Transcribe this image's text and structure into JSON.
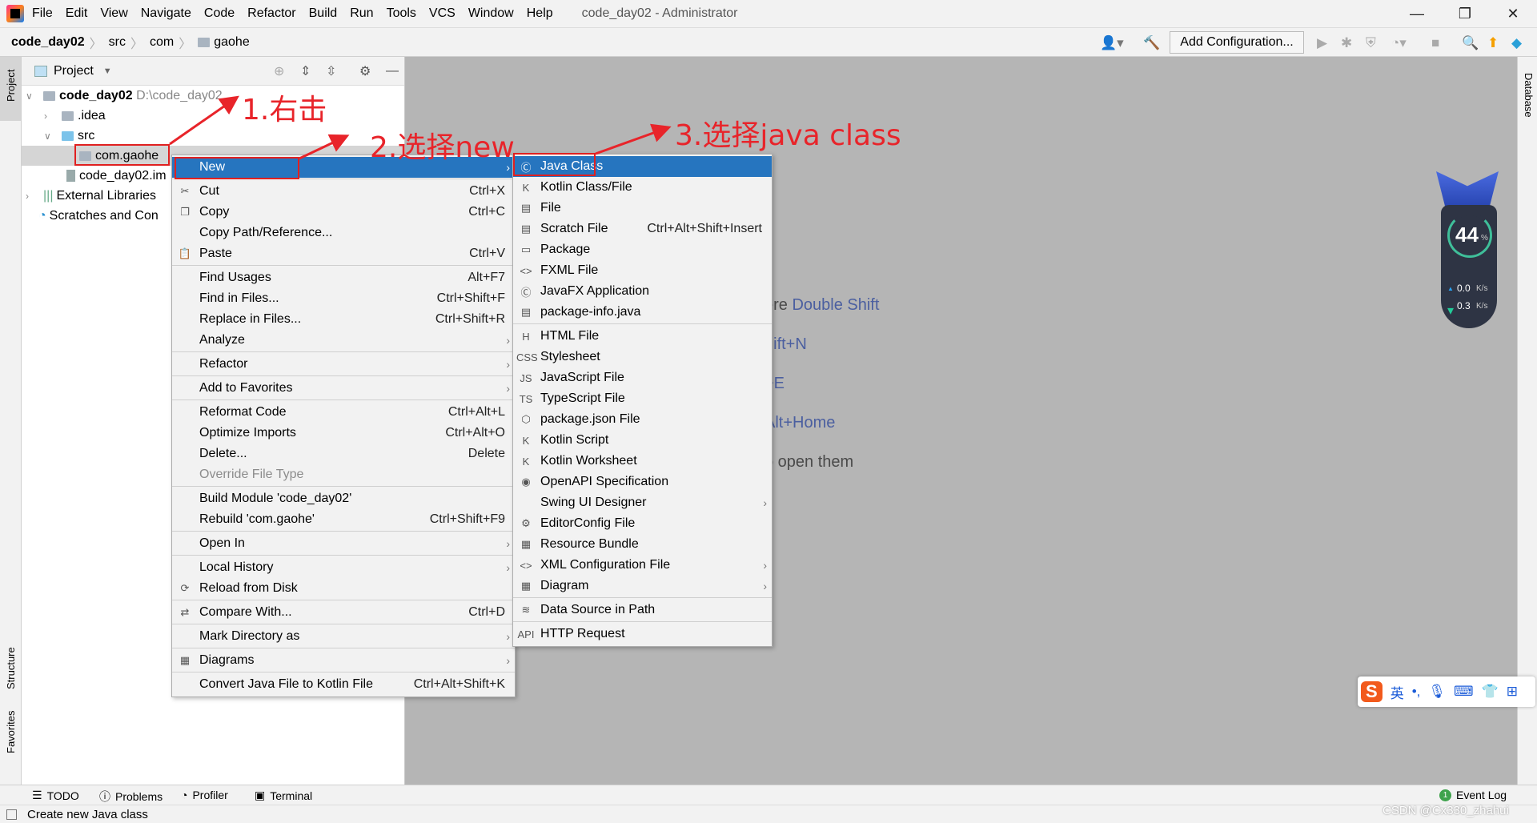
{
  "titlebar": {
    "menus": [
      "File",
      "Edit",
      "View",
      "Navigate",
      "Code",
      "Refactor",
      "Build",
      "Run",
      "Tools",
      "VCS",
      "Window",
      "Help"
    ],
    "title": "code_day02 - Administrator",
    "minimize": "—",
    "restore": "❐",
    "close": "✕"
  },
  "navbar": {
    "crumbs": [
      "code_day02",
      "src",
      "com",
      "gaohe"
    ],
    "add_configuration": "Add Configuration..."
  },
  "leftstrip": {
    "project": "Project",
    "structure": "Structure",
    "favorites": "Favorites"
  },
  "rightstrip": {
    "database": "Database"
  },
  "project": {
    "header": "Project",
    "tree": [
      {
        "label": "code_day02",
        "path": "D:\\code_day02",
        "bold": true
      },
      {
        "label": ".idea"
      },
      {
        "label": "src"
      },
      {
        "label": "com.gaohe"
      },
      {
        "label": "code_day02.im"
      },
      {
        "label": "External Libraries"
      },
      {
        "label": "Scratches and Con"
      }
    ]
  },
  "editor": {
    "hints": [
      {
        "text": "ere ",
        "key": "Double Shift"
      },
      {
        "text": "",
        "key": "hift+N"
      },
      {
        "text": "",
        "key": "+E"
      },
      {
        "text": "",
        "key": "Alt+Home"
      },
      {
        "text": "o open them",
        "key": ""
      }
    ]
  },
  "context_menu": [
    {
      "label": "New",
      "arrow": true,
      "highlight": true,
      "icon": ""
    },
    {
      "label": "Cut",
      "shortcut": "Ctrl+X",
      "icon": "✂",
      "sep": true
    },
    {
      "label": "Copy",
      "shortcut": "Ctrl+C",
      "icon": "❐"
    },
    {
      "label": "Copy Path/Reference..."
    },
    {
      "label": "Paste",
      "shortcut": "Ctrl+V",
      "icon": "📋"
    },
    {
      "label": "Find Usages",
      "shortcut": "Alt+F7",
      "sep": true
    },
    {
      "label": "Find in Files...",
      "shortcut": "Ctrl+Shift+F"
    },
    {
      "label": "Replace in Files...",
      "shortcut": "Ctrl+Shift+R"
    },
    {
      "label": "Analyze",
      "arrow": true
    },
    {
      "label": "Refactor",
      "arrow": true,
      "sep": true
    },
    {
      "label": "Add to Favorites",
      "arrow": true,
      "sep": true
    },
    {
      "label": "Reformat Code",
      "shortcut": "Ctrl+Alt+L",
      "sep": true
    },
    {
      "label": "Optimize Imports",
      "shortcut": "Ctrl+Alt+O"
    },
    {
      "label": "Delete...",
      "shortcut": "Delete"
    },
    {
      "label": "Override File Type",
      "disabled": true
    },
    {
      "label": "Build Module 'code_day02'",
      "sep": true
    },
    {
      "label": "Rebuild 'com.gaohe'",
      "shortcut": "Ctrl+Shift+F9"
    },
    {
      "label": "Open In",
      "arrow": true,
      "sep": true
    },
    {
      "label": "Local History",
      "arrow": true,
      "sep": true
    },
    {
      "label": "Reload from Disk",
      "icon": "⟳"
    },
    {
      "label": "Compare With...",
      "shortcut": "Ctrl+D",
      "icon": "⇄",
      "sep": true
    },
    {
      "label": "Mark Directory as",
      "arrow": true,
      "sep": true
    },
    {
      "label": "Diagrams",
      "arrow": true,
      "icon": "▦",
      "sep": true
    },
    {
      "label": "Convert Java File to Kotlin File",
      "shortcut": "Ctrl+Alt+Shift+K",
      "sep": true
    }
  ],
  "submenu": [
    {
      "label": "Java Class",
      "icon": "Ⓒ",
      "highlight": true
    },
    {
      "label": "Kotlin Class/File",
      "icon": "K"
    },
    {
      "label": "File",
      "icon": "▤"
    },
    {
      "label": "Scratch File",
      "icon": "▤",
      "shortcut": "Ctrl+Alt+Shift+Insert"
    },
    {
      "label": "Package",
      "icon": "▭"
    },
    {
      "label": "FXML File",
      "icon": "<>"
    },
    {
      "label": "JavaFX Application",
      "icon": "Ⓒ"
    },
    {
      "label": "package-info.java",
      "icon": "▤"
    },
    {
      "label": "HTML File",
      "icon": "H",
      "sep": true
    },
    {
      "label": "Stylesheet",
      "icon": "CSS"
    },
    {
      "label": "JavaScript File",
      "icon": "JS"
    },
    {
      "label": "TypeScript File",
      "icon": "TS"
    },
    {
      "label": "package.json File",
      "icon": "⬡"
    },
    {
      "label": "Kotlin Script",
      "icon": "K"
    },
    {
      "label": "Kotlin Worksheet",
      "icon": "K"
    },
    {
      "label": "OpenAPI Specification",
      "icon": "◉"
    },
    {
      "label": "Swing UI Designer",
      "arrow": true
    },
    {
      "label": "EditorConfig File",
      "icon": "⚙"
    },
    {
      "label": "Resource Bundle",
      "icon": "▦"
    },
    {
      "label": "XML Configuration File",
      "icon": "<>",
      "arrow": true
    },
    {
      "label": "Diagram",
      "icon": "▦",
      "arrow": true
    },
    {
      "label": "Data Source in Path",
      "icon": "≋",
      "sep": true
    },
    {
      "label": "HTTP Request",
      "icon": "API",
      "sep": true
    }
  ],
  "annotations": {
    "step1": "1.右击",
    "step2": "2.选择new",
    "step3": "3.选择java class",
    "color": "#e8242a"
  },
  "widget": {
    "percent": "44",
    "percent_sign": "%",
    "up": "0.0",
    "down": "0.3",
    "unit": "K/s"
  },
  "ime": {
    "lang": "英",
    "punct": "•,"
  },
  "bottombar": {
    "todo": "TODO",
    "problems": "Problems",
    "profiler": "Profiler",
    "terminal": "Terminal",
    "event_log": "Event Log",
    "event_count": "1"
  },
  "status": {
    "text": "Create new Java class"
  },
  "watermark": "CSDN @Cx330_zhahui",
  "colors": {
    "highlight": "#2675bf",
    "editor_bg": "#b5b5b5",
    "annotation": "#e8242a"
  }
}
